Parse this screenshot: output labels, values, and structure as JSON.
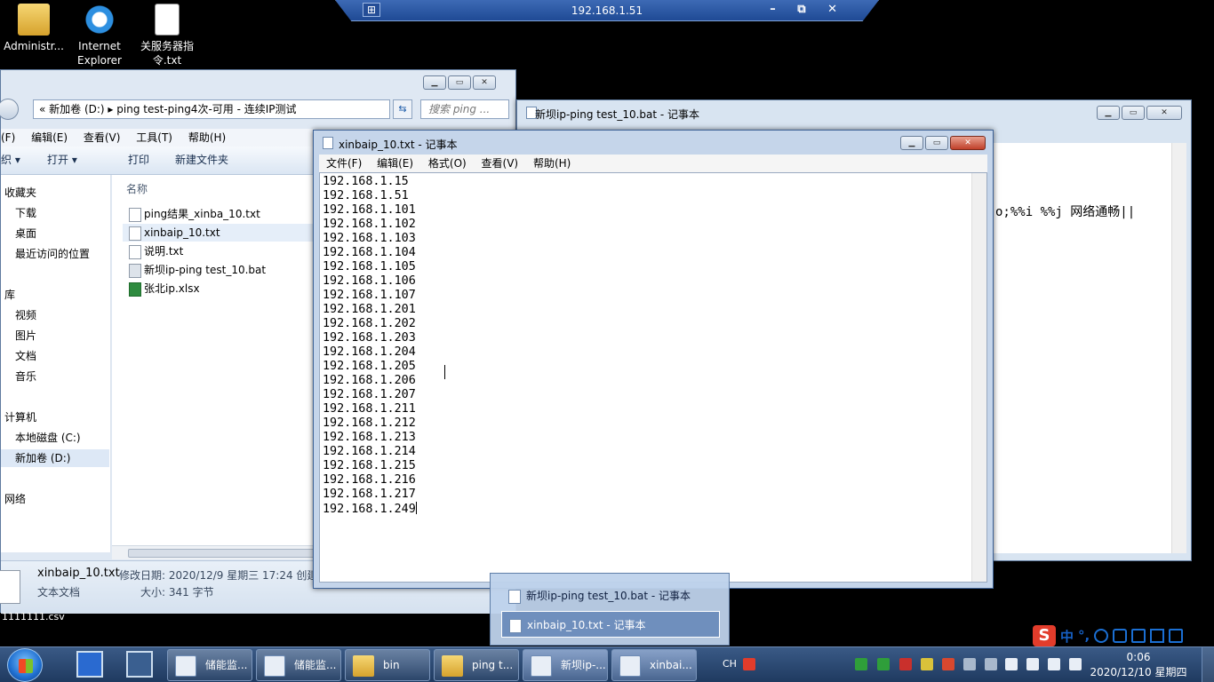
{
  "desktop": {
    "icons": [
      {
        "label": "Administr..."
      },
      {
        "label": "Internet Explorer"
      },
      {
        "label": "关服务器指令.txt"
      }
    ]
  },
  "rdp": {
    "title": "192.168.1.51",
    "pin": "⊞",
    "controls": "– ⧉ ✕"
  },
  "explorer": {
    "address": "«  新加卷 (D:)  ▸  ping test-ping4次-可用 - 连续IP测试",
    "search_placeholder": "搜索 ping ...",
    "menu": [
      "(F)",
      "编辑(E)",
      "查看(V)",
      "工具(T)",
      "帮助(H)"
    ],
    "toolbar": {
      "organize": "织 ▾",
      "open": "打开 ▾",
      "print": "打印",
      "new_folder": "新建文件夹"
    },
    "nav": [
      {
        "label": "收藏夹"
      },
      {
        "label": "下载"
      },
      {
        "label": "桌面"
      },
      {
        "label": "最近访问的位置"
      },
      {
        "label": "库"
      },
      {
        "label": "视频"
      },
      {
        "label": "图片"
      },
      {
        "label": "文档"
      },
      {
        "label": "音乐"
      },
      {
        "label": "计算机"
      },
      {
        "label": "本地磁盘 (C:)"
      },
      {
        "label": "新加卷 (D:)"
      },
      {
        "label": "网络"
      }
    ],
    "column_name": "名称",
    "files": [
      {
        "name": "ping结果_xinba_10.txt"
      },
      {
        "name": "xinbaip_10.txt"
      },
      {
        "name": "说明.txt"
      },
      {
        "name": "新坝ip-ping test_10.bat"
      },
      {
        "name": "张北ip.xlsx"
      }
    ],
    "status": {
      "name": "xinbaip_10.txt",
      "modified": "修改日期: 2020/12/9 星期三 17:24 创建",
      "type": "文本文档",
      "size": "大小: 341 字节"
    },
    "below_text": "1111111.csv"
  },
  "notepad_back": {
    "title": "新坝ip-ping test_10.bat - 记事本",
    "visible_fragment": "o;%%i %%j 网络通畅||"
  },
  "notepad_front": {
    "title": "xinbaip_10.txt - 记事本",
    "menu": [
      "文件(F)",
      "编辑(E)",
      "格式(O)",
      "查看(V)",
      "帮助(H)"
    ],
    "lines": [
      "192.168.1.15",
      "192.168.1.51",
      "192.168.1.101",
      "192.168.1.102",
      "192.168.1.103",
      "192.168.1.104",
      "192.168.1.105",
      "192.168.1.106",
      "192.168.1.107",
      "192.168.1.201",
      "192.168.1.202",
      "192.168.1.203",
      "192.168.1.204",
      "192.168.1.205",
      "192.168.1.206",
      "192.168.1.207",
      "192.168.1.211",
      "192.168.1.212",
      "192.168.1.213",
      "192.168.1.214",
      "192.168.1.215",
      "192.168.1.216",
      "192.168.1.217",
      "192.168.1.249"
    ]
  },
  "taskbar_popup": [
    {
      "label": "新坝ip-ping test_10.bat - 记事本"
    },
    {
      "label": "xinbaip_10.txt - 记事本"
    }
  ],
  "taskbar": {
    "buttons": [
      {
        "label": "储能监..."
      },
      {
        "label": "储能监..."
      },
      {
        "label": "bin"
      },
      {
        "label": "ping t..."
      },
      {
        "label": "新坝ip-..."
      },
      {
        "label": "xinbai..."
      }
    ],
    "lang": "CH",
    "time": "0:06",
    "date": "2020/12/10 星期四"
  },
  "ime": {
    "logo": "S",
    "mode": "中",
    "punct": "°,"
  }
}
